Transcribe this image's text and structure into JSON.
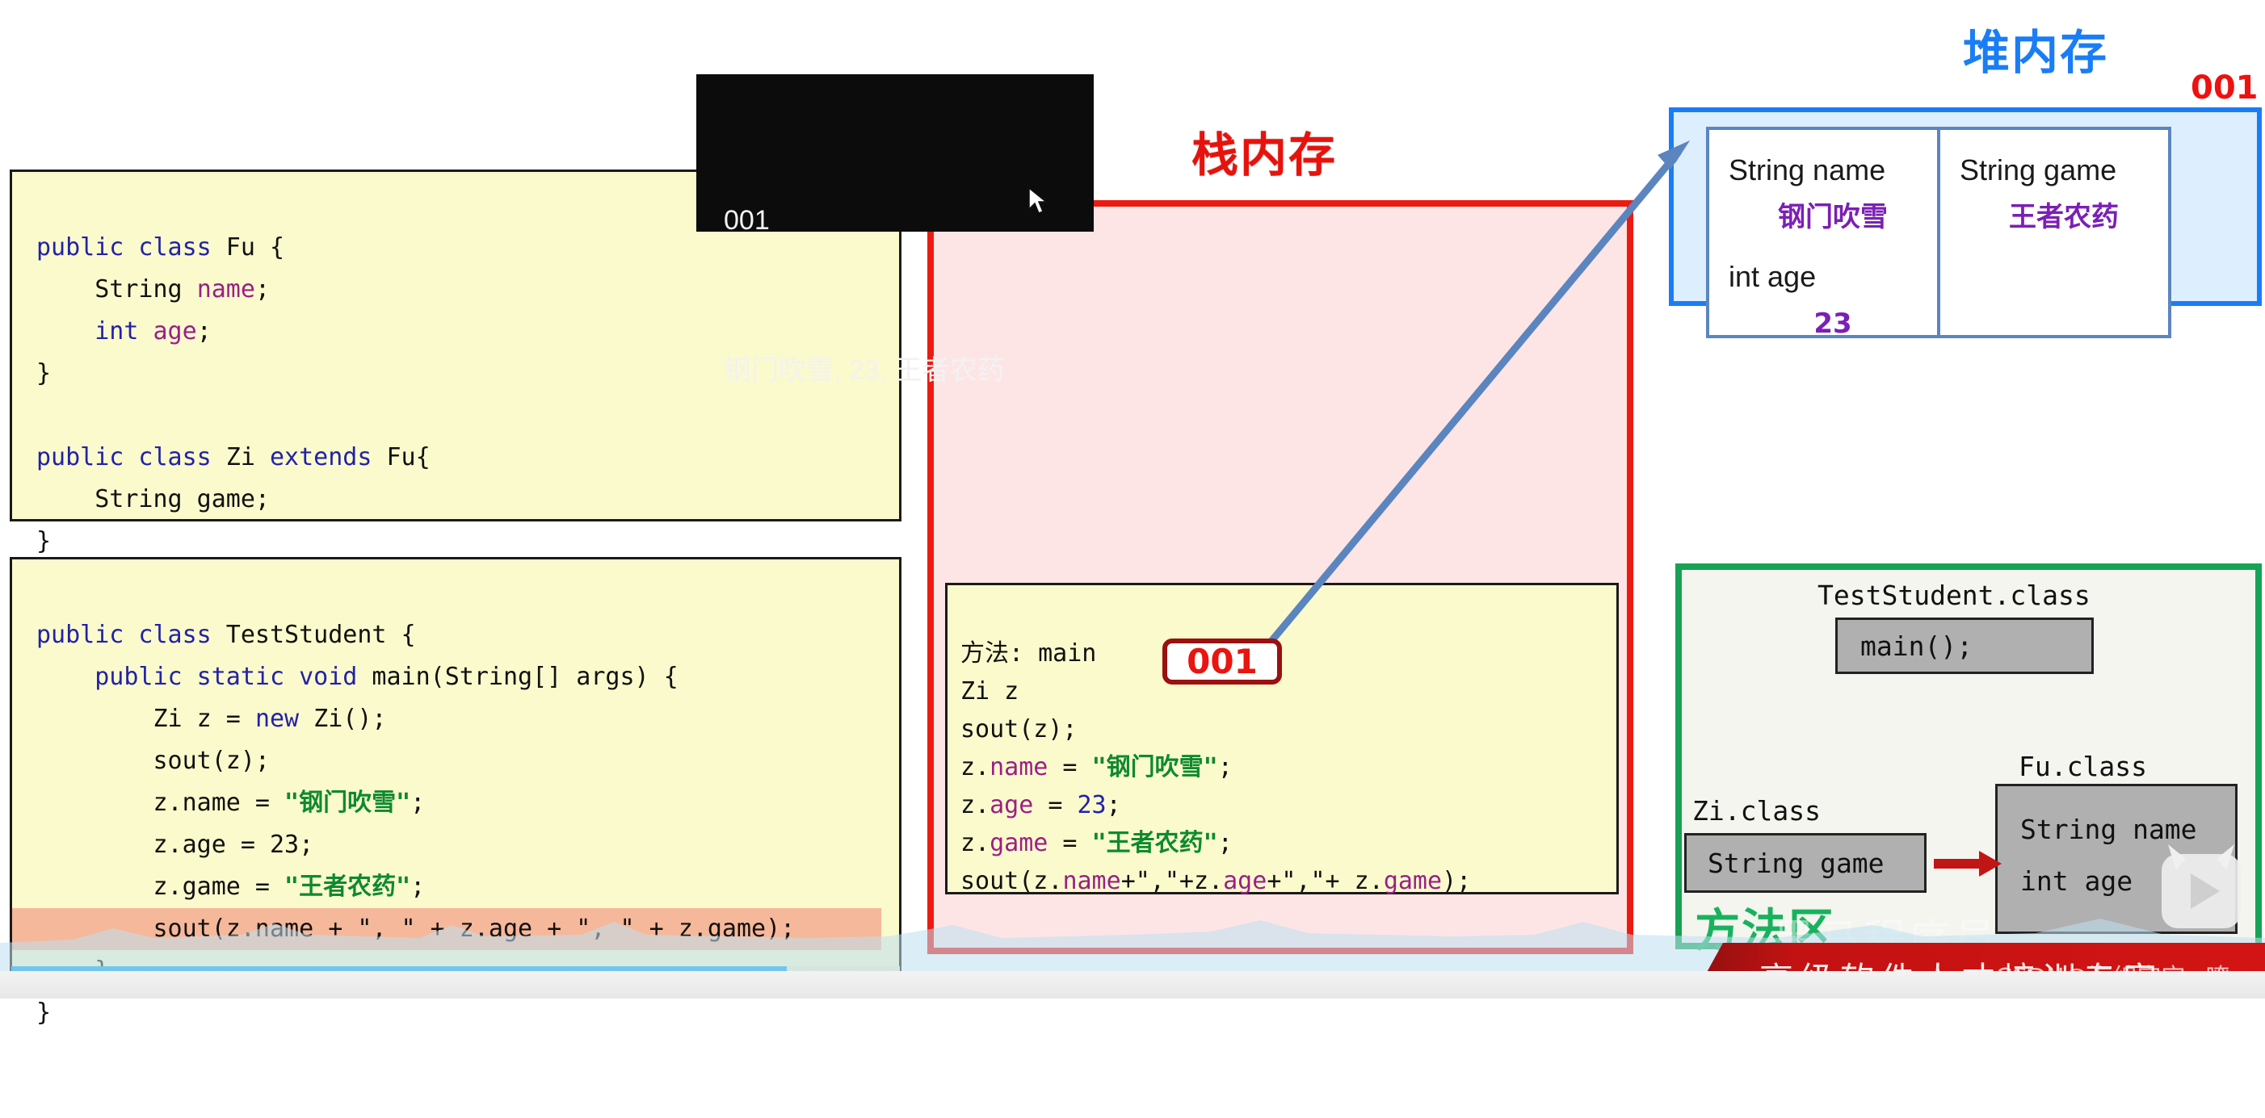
{
  "console": {
    "line1": "001",
    "line2": "钢门吹雪, 23, 王者农药"
  },
  "code_top": {
    "lines": [
      "public class Fu {",
      "    String name;",
      "    int age;",
      "}",
      "",
      "public class Zi extends Fu{",
      "    String game;",
      "}"
    ]
  },
  "code_bottom": {
    "lines": [
      "public class TestStudent {",
      "    public static void main(String[] args) {",
      "        Zi z = new Zi();",
      "        sout(z);",
      "        z.name = \"钢门吹雪\";",
      "        z.age = 23;",
      "        z.game = \"王者农药\";",
      "        sout(z.name + \", \" + z.age + \", \" + z.game);",
      "    }",
      "}"
    ],
    "highlighted_line_index": 7
  },
  "stack": {
    "title": "栈内存",
    "frame_lines": [
      "方法: main",
      "Zi z",
      "sout(z);",
      "z.name = \"钢门吹雪\";",
      "z.age = 23;",
      "z.game = \"王者农药\";",
      "sout(z.name+\",\"+z.age+\",\"+ z.game);"
    ],
    "address_chip": "001"
  },
  "heap": {
    "title": "堆内存",
    "object_id": "001",
    "fields": [
      {
        "declaration": "String name",
        "value": "钢门吹雪",
        "second_declaration": "int age",
        "second_value": "23"
      },
      {
        "declaration": "String game",
        "value": "王者农药"
      }
    ]
  },
  "method_area": {
    "label": "方法区",
    "test_student_class": "TestStudent.class",
    "main_method": "main();",
    "fu_class": "Fu.class",
    "fu_fields": [
      "String name",
      "int age"
    ],
    "zi_class": "Zi.class",
    "zi_field": "String game"
  },
  "watermark": {
    "banner_text": "高级软件人才培训专家",
    "brand_text": "黑马程序员",
    "csdn": "CSDN@海绵宝宝~嘹"
  },
  "colors": {
    "stack_red": "#ec1b12",
    "heap_blue": "#1a7df5",
    "method_green": "#17a355",
    "code_bg": "#fbfacd",
    "highlight": "#f6b89a",
    "string_green": "#0e8a2e",
    "field_purple": "#9b1f86",
    "keyword_blue": "#2222a8",
    "heap_value_purple": "#7b1fb5"
  }
}
